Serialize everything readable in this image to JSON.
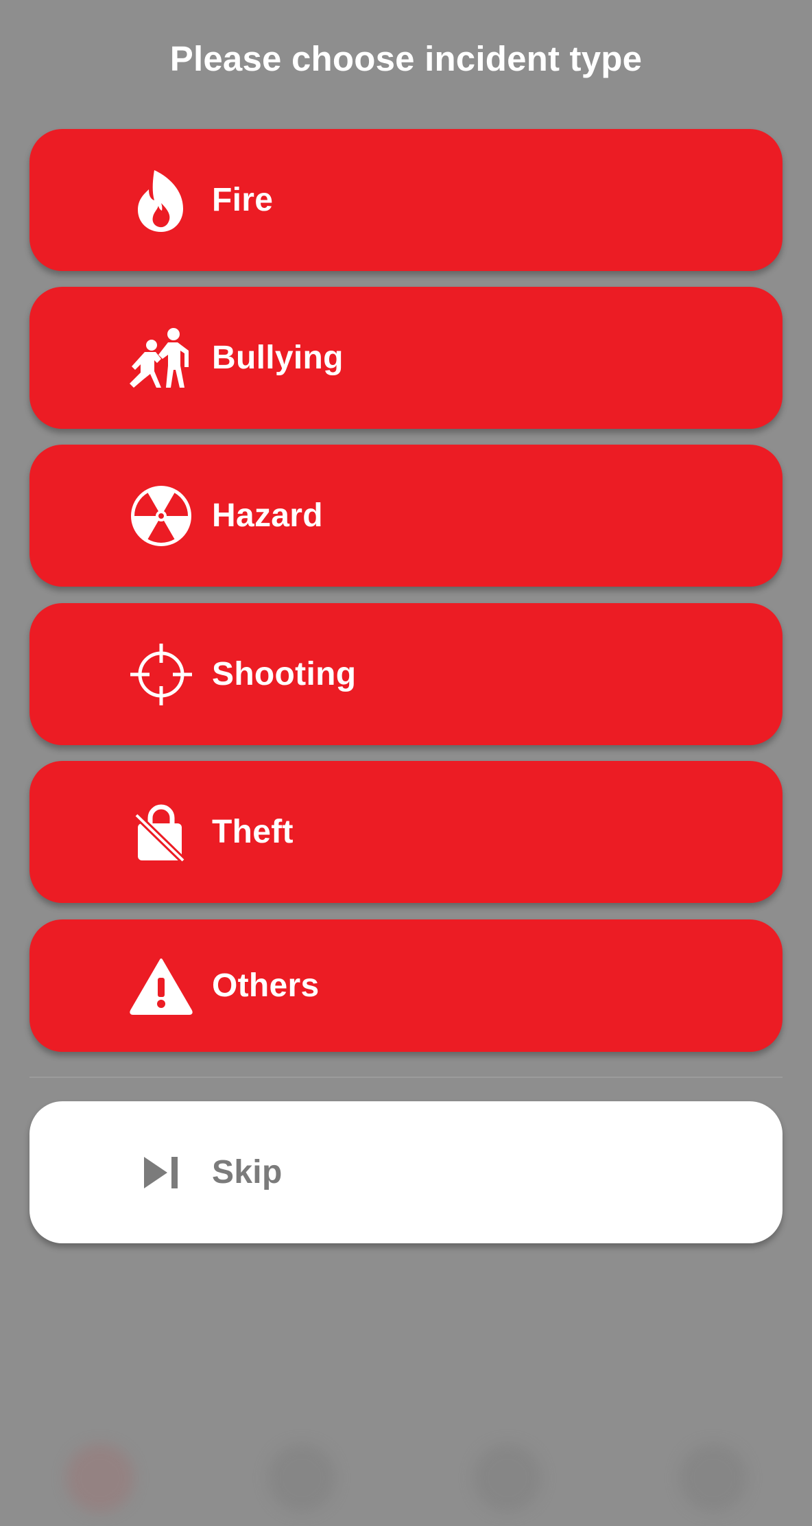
{
  "header": {
    "title": "Please choose incident type"
  },
  "options": [
    {
      "label": "Fire",
      "icon": "fire-icon"
    },
    {
      "label": "Bullying",
      "icon": "bullying-icon"
    },
    {
      "label": "Hazard",
      "icon": "radiation-hazard-icon"
    },
    {
      "label": "Shooting",
      "icon": "crosshair-icon"
    },
    {
      "label": "Theft",
      "icon": "theft-bag-icon"
    },
    {
      "label": "Others",
      "icon": "warning-icon"
    }
  ],
  "skip": {
    "label": "Skip",
    "icon": "skip-next-icon"
  },
  "colors": {
    "background": "#8e8e8e",
    "accent_red": "#ec1c24",
    "skip_background": "#ffffff",
    "skip_text": "#7b7b7b"
  }
}
